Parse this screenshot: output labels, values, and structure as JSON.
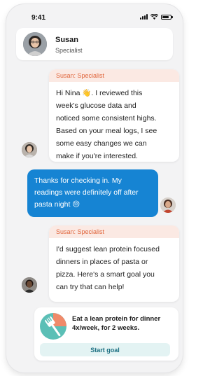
{
  "status_bar": {
    "time": "9:41"
  },
  "header": {
    "name": "Susan",
    "role": "Specialist"
  },
  "messages": [
    {
      "sender": "Susan: Specialist",
      "text": "Hi Nina 👋. I reviewed this\nweek's glucose data and\nnoticed some consistent highs.\nBased on your meal logs, I see\nsome easy changes we can\nmake if you're interested."
    },
    {
      "text": "Thanks for checking in. My\nreadings were definitely off after\npasta night 😔"
    },
    {
      "sender": "Susan: Specialist",
      "text": "I'd suggest lean protein focused\ndinners in places of pasta or\npizza. Here's a smart goal you\ncan try that can help!"
    }
  ],
  "goal_card": {
    "text": "Eat a lean protein for dinner 4x/week, for 2 weeks.",
    "button_label": "Start goal"
  },
  "colors": {
    "user_bubble": "#1684d3",
    "header_tint": "#fbe9e3",
    "sender_text": "#e0663d",
    "goal_icon_bg": "#5bbfb6"
  }
}
